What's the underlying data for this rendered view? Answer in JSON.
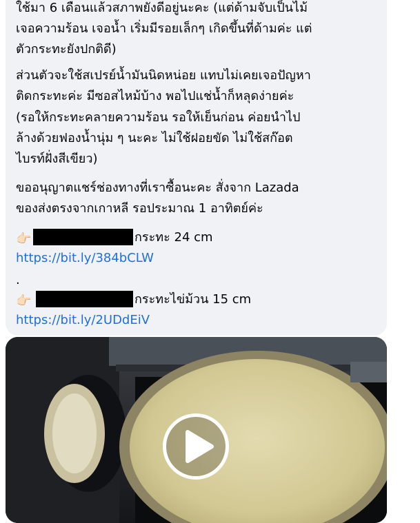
{
  "post": {
    "paragraph1": [
      "ใช้มา 6 เดือนแล้วสภาพยังดีอยู่นะคะ (แต่ด้ามจับเป็นไม้",
      "เจอความร้อน เจอน้ำ เริ่มมีรอยเล็กๆ เกิดขึ้นที่ด้ามค่ะ แต่",
      "ตัวกระทะยังปกติดี)"
    ],
    "paragraph2": [
      "ส่วนตัวจะใช้สเปรย์น้ำมันนิดหน่อย แทบไม่เคยเจอปัญหา",
      "ติดกระทะค่ะ มีซอสไหม้บ้าง พอไปแช่น้ำก็หลุดง่ายค่ะ",
      "(รอให้กระทะคลายความร้อน รอให้เย็นก่อน ค่อยนำไป",
      "ล้างด้วยฟองน้ำนุ่ม ๆ นะคะ ไม่ใช้ฝอยขัด ไม่ใช้สก๊อต",
      "ไบรท์ฝั่งสีเขียว)"
    ],
    "paragraph3": [
      "ขออนุญาตแชร์ช่องทางที่เราซื้อนะคะ สั่งจาก Lazada",
      "ของส่งตรงจากเกาหลี รอประมาณ 1 อาทิตย์ค่ะ"
    ],
    "items": [
      {
        "emoji": "👉🏻",
        "label": "กระทะ 24 cm",
        "link": "https://bit.ly/384bCLW"
      },
      {
        "emoji": "👉🏻",
        "label": "กระทะไข่ม้วน 15 cm",
        "link": "https://bit.ly/2UDdEiV"
      }
    ],
    "separator": "."
  },
  "video": {
    "icon": "play-icon"
  },
  "colors": {
    "bubble": "#f0f2f5",
    "link": "#216fdb",
    "text": "#050505"
  }
}
